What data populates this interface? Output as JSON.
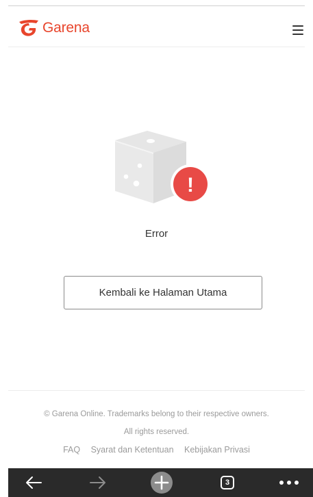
{
  "header": {
    "brand": "Garena",
    "brand_color": "#e8452c",
    "logo_icon": "garena-logo-icon",
    "menu_icon": "hamburger-menu-icon"
  },
  "main": {
    "illustration_icon": "dice-error-icon",
    "alert_symbol": "!",
    "alert_color": "#e84a46",
    "error_text": "Error",
    "home_button_label": "Kembali ke Halaman Utama"
  },
  "footer": {
    "copyright": "© Garena Online. Trademarks belong to their respective owners. All rights reserved.",
    "links": [
      {
        "label": "FAQ"
      },
      {
        "label": "Syarat dan Ketentuan"
      },
      {
        "label": "Kebijakan Privasi"
      }
    ]
  },
  "browser_bar": {
    "background": "#2a2a2a",
    "back_icon": "arrow-left-icon",
    "forward_icon": "arrow-right-icon",
    "new_tab_icon": "plus-circle-icon",
    "tab_count": "3",
    "more_icon": "more-dots-icon"
  }
}
